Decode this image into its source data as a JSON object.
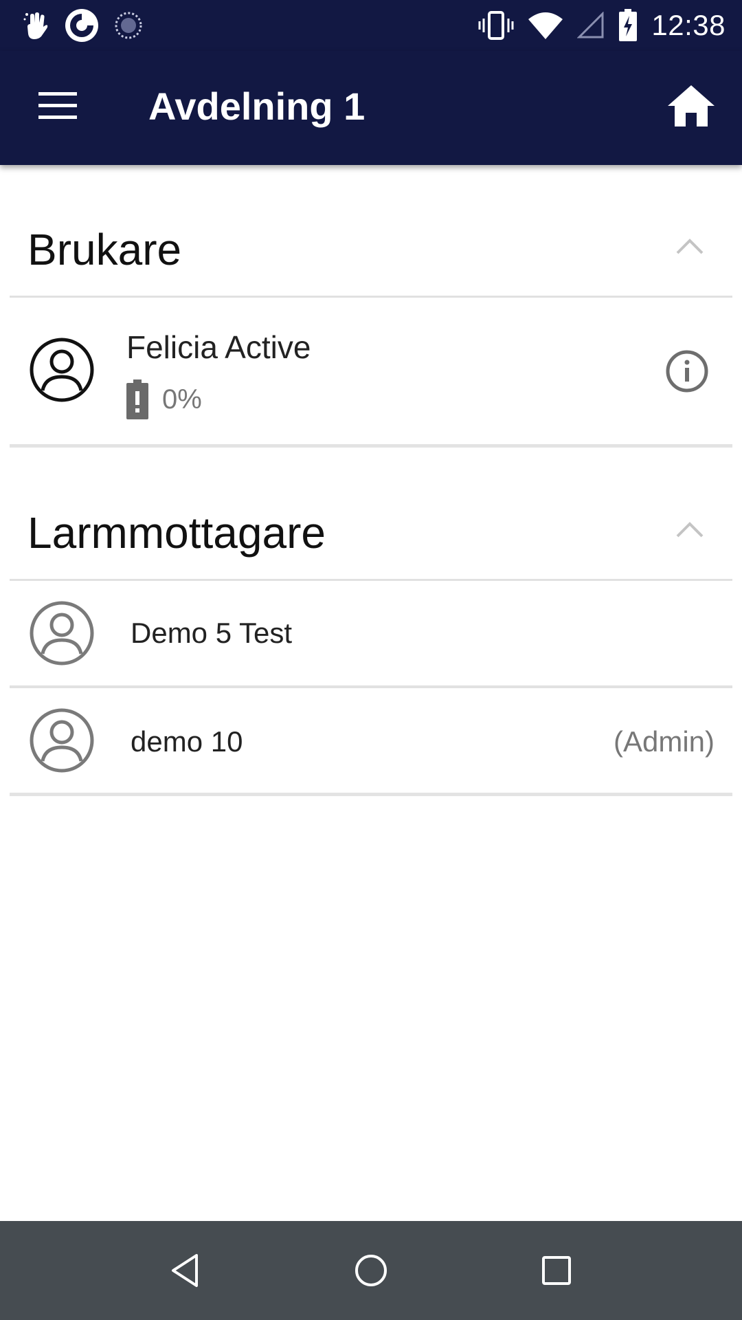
{
  "status_bar": {
    "time": "12:38",
    "left_icons": [
      "hand-gesture-icon",
      "app-logo-icon",
      "sync-icon"
    ],
    "right_icons": [
      "vibrate-icon",
      "wifi-icon",
      "signal-icon",
      "battery-charging-icon"
    ]
  },
  "app_bar": {
    "title": "Avdelning 1",
    "menu_icon": "hamburger-menu-icon",
    "home_icon": "home-icon"
  },
  "sections": [
    {
      "title": "Brukare",
      "expanded": true,
      "items": [
        {
          "name": "Felicia Active",
          "battery": "0%",
          "battery_icon": "battery-alert-icon",
          "action_icon": "info-icon"
        }
      ]
    },
    {
      "title": "Larmmottagare",
      "expanded": true,
      "items": [
        {
          "name": "Demo 5 Test",
          "role": ""
        },
        {
          "name": "demo 10",
          "role": "(Admin)"
        }
      ]
    }
  ],
  "nav_bar": {
    "icons": [
      "back-icon",
      "home-nav-icon",
      "recents-icon"
    ]
  },
  "colors": {
    "app_bar": "#121843",
    "nav_bar": "#464c51",
    "divider": "#e1e1e1",
    "secondary_text": "#777777"
  }
}
